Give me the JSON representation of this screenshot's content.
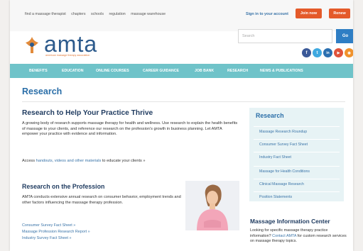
{
  "topbar": {
    "links": [
      "find a massage therapist",
      "chapters",
      "schools",
      "regulation",
      "massage warehouse"
    ],
    "signin": "Sign in to your account",
    "join": "Join now",
    "renew": "Renew"
  },
  "brand": {
    "name": "amta",
    "tagline": "american massage therapy association"
  },
  "search": {
    "placeholder": "Search",
    "button": "Go"
  },
  "social": [
    {
      "icon": "facebook-icon",
      "glyph": "f",
      "color": "#3b5998"
    },
    {
      "icon": "twitter-icon",
      "glyph": "t",
      "color": "#3fa9e0"
    },
    {
      "icon": "linkedin-icon",
      "glyph": "in",
      "color": "#2a6fb0"
    },
    {
      "icon": "youtube-icon",
      "glyph": "▶",
      "color": "#e0533a"
    },
    {
      "icon": "rss-icon",
      "glyph": "◉",
      "color": "#f0922c"
    }
  ],
  "nav": [
    "BENEFITS",
    "EDUCATION",
    "ONLINE COURSES",
    "CAREER GUIDANCE",
    "JOB BANK",
    "RESEARCH",
    "NEWS & PUBLICATIONS"
  ],
  "page_title": "Research",
  "main": {
    "heading": "Research to Help Your Practice Thrive",
    "intro": "A growing body of research supports massage therapy for health and wellness. Use research to explain the health benefits of massage to your clients, and reference our research on the profession's growth in business planning. Let AMTA empower your practice with evidence and information.",
    "access_prefix": "Access ",
    "access_link": "handouts, videos and other materials",
    "access_suffix": " to educate your clients »",
    "profession_heading": "Research on the Profession",
    "profession_text": "AMTA conducts extensive annual research on consumer behavior, employment trends and other factors influencing the massage therapy profession.",
    "links": [
      "Consumer Survey Fact Sheet »",
      "Massage Profession Research Report »",
      "Industry Survey Fact Sheet »"
    ]
  },
  "sidebar": {
    "title": "Research",
    "items": [
      "Massage Research Roundup",
      "Consumer Survey Fact Sheet",
      "Industry Fact Sheet",
      "Massage for Health Conditions",
      "Clinical Massage Research",
      "Position Statements"
    ]
  },
  "info_center": {
    "heading": "Massage Information Center",
    "text_prefix": "Looking for specific massage therapy practice information? ",
    "link": "Contact AMTA",
    "text_suffix": " for custom research services on massage therapy topics."
  },
  "colors": {
    "accent": "#2a6ea8",
    "nav": "#6fc3c9",
    "button": "#e45a2a",
    "sidebar_bg": "#e7f3f5"
  }
}
